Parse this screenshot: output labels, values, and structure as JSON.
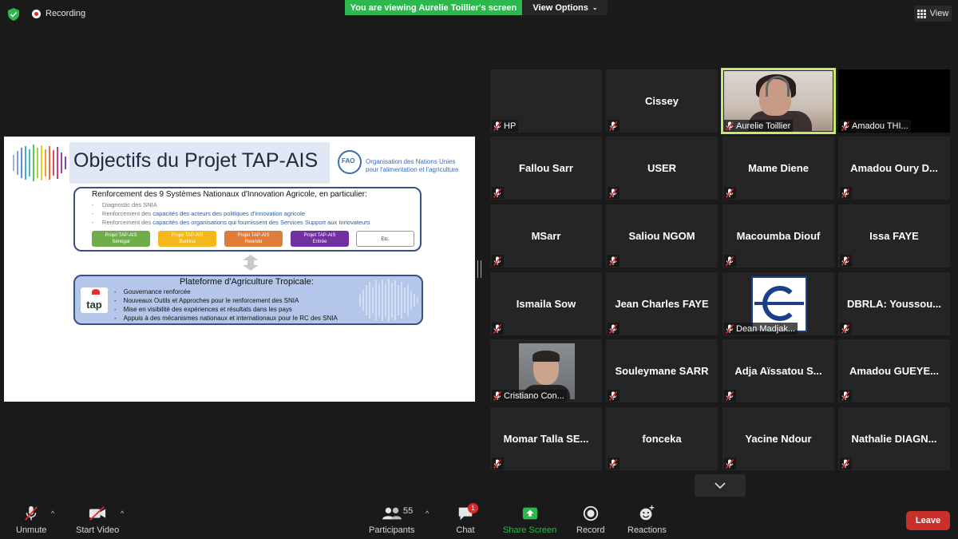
{
  "top_bar": {
    "recording_label": "Recording",
    "viewing_banner": "You are viewing Aurelie Toillier's screen",
    "view_options_label": "View Options",
    "view_label": "View"
  },
  "slide": {
    "title": "Objectifs du Projet TAP-AIS",
    "org_line1": "Organisation des Nations Unies",
    "org_line2": "pour l'alimentation et l'agriculture",
    "box1_heading": "Renforcement des 9 Systèmes Nationaux d'Innovation Agricole, en particulier:",
    "box1_bullets": [
      {
        "prefix": "Diagnostic des SNIA",
        "highlight": ""
      },
      {
        "prefix": "Renforcement des ",
        "highlight": "capacités des acteurs des politiques d'innovation agricole"
      },
      {
        "prefix": "Renforcement des ",
        "highlight": "capacités des organisations qui fournissent des Services Support aux Innovateurs"
      }
    ],
    "projects": [
      {
        "line1": "Projet TAP-AIS",
        "line2": "Sénégal",
        "color": "#6fad4b"
      },
      {
        "line1": "Projet TAP-AIS",
        "line2": "Burkina",
        "color": "#f2b81c"
      },
      {
        "line1": "Projet TAP-AIS",
        "line2": "Rwanda",
        "color": "#e07b39"
      },
      {
        "line1": "Projet TAP-AIS",
        "line2": "Eritrée",
        "color": "#7030a0"
      }
    ],
    "projects_etc": "Etc.",
    "box2_heading": "Plateforme d'Agriculture Tropicale:",
    "tap_logo_text": "tap",
    "box2_bullets": [
      "Gouvernance renforcée",
      "Nouveaux Outils et Approches pour le renforcement des SNIA",
      "Mise en visibilité des expériences et résultats dans les pays",
      "Appuis à des mécanismes nationaux et internationaux pour le RC des SNIA"
    ]
  },
  "participants": [
    {
      "center": "",
      "label": "HP"
    },
    {
      "center": "Cissey",
      "label": ""
    },
    {
      "center": "",
      "label": "Aurelie Toillier",
      "video": "aurelie",
      "active": true
    },
    {
      "center": "",
      "label": "Amadou THI...",
      "video": "black"
    },
    {
      "center": "Fallou Sarr",
      "label": ""
    },
    {
      "center": "USER",
      "label": ""
    },
    {
      "center": "Mame Diene",
      "label": ""
    },
    {
      "center": "Amadou Oury D...",
      "label": ""
    },
    {
      "center": "MSarr",
      "label": ""
    },
    {
      "center": "Saliou NGOM",
      "label": ""
    },
    {
      "center": "Macoumba Diouf",
      "label": ""
    },
    {
      "center": "Issa FAYE",
      "label": ""
    },
    {
      "center": "Ismaila Sow",
      "label": ""
    },
    {
      "center": "Jean Charles FAYE",
      "label": ""
    },
    {
      "center": "",
      "label": "Dean Madjak...",
      "video": "dean"
    },
    {
      "center": "DBRLA: Youssou...",
      "label": ""
    },
    {
      "center": "",
      "label": "Cristiano Con...",
      "video": "cristiano"
    },
    {
      "center": "Souleymane SARR",
      "label": ""
    },
    {
      "center": "Adja Aïssatou S...",
      "label": ""
    },
    {
      "center": "Amadou GUEYE...",
      "label": ""
    },
    {
      "center": "Momar Talla SE...",
      "label": ""
    },
    {
      "center": "fonceka",
      "label": ""
    },
    {
      "center": "Yacine Ndour",
      "label": ""
    },
    {
      "center": "Nathalie DIAGN...",
      "label": ""
    }
  ],
  "toolbar": {
    "unmute": "Unmute",
    "start_video": "Start Video",
    "participants": "Participants",
    "participant_count": "55",
    "chat": "Chat",
    "chat_badge": "1",
    "share_screen": "Share Screen",
    "record": "Record",
    "reactions": "Reactions",
    "leave": "Leave"
  },
  "colors": {
    "banner_green": "#2db84d",
    "leave_red": "#c9302c",
    "active_speaker": "#c7e86a"
  }
}
